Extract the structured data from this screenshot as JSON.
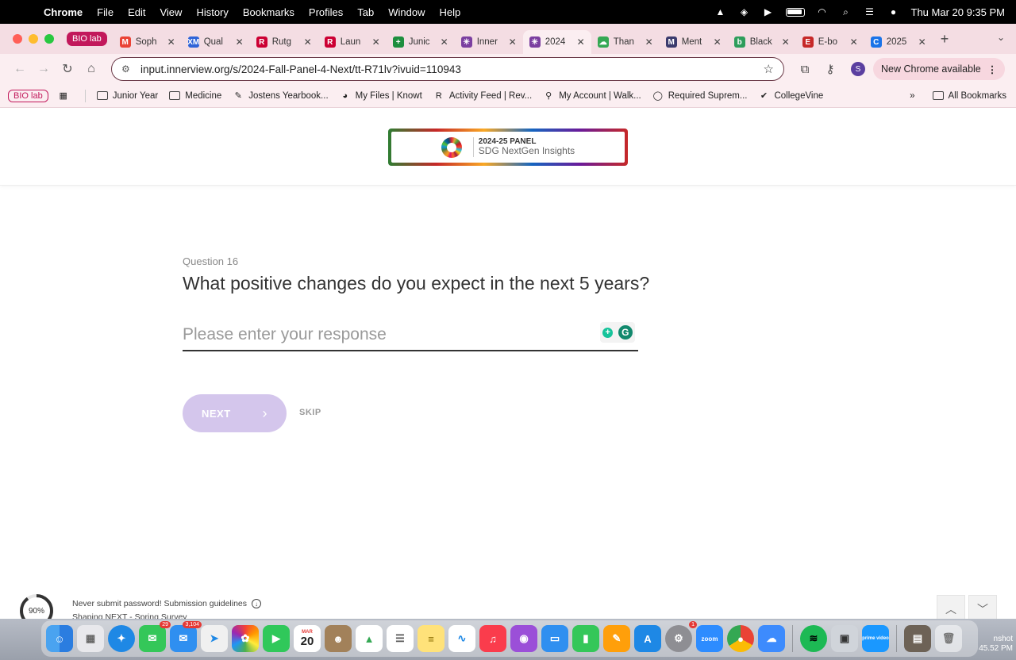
{
  "menubar": {
    "app": "Chrome",
    "items": [
      "File",
      "Edit",
      "View",
      "History",
      "Bookmarks",
      "Profiles",
      "Tab",
      "Window",
      "Help"
    ],
    "clock": "Thu Mar 20  9:35 PM"
  },
  "tabs": {
    "group_label": "BIO lab",
    "items": [
      {
        "label": "Soph",
        "favicon_color": "#ea4335",
        "favicon_glyph": "M"
      },
      {
        "label": "Qual",
        "favicon_color": "#2f64d8",
        "favicon_glyph": "XM"
      },
      {
        "label": "Rutg",
        "favicon_color": "#cc0033",
        "favicon_glyph": "R"
      },
      {
        "label": "Laun",
        "favicon_color": "#cc0033",
        "favicon_glyph": "R"
      },
      {
        "label": "Junic",
        "favicon_color": "#1e8e3e",
        "favicon_glyph": "+"
      },
      {
        "label": "Inner",
        "favicon_color": "#7b3fa0",
        "favicon_glyph": "✳"
      },
      {
        "label": "2024",
        "favicon_color": "#7b3fa0",
        "favicon_glyph": "✳"
      },
      {
        "label": "Than",
        "favicon_color": "#34a853",
        "favicon_glyph": "☁"
      },
      {
        "label": "Ment",
        "favicon_color": "#3b3b6d",
        "favicon_glyph": "M"
      },
      {
        "label": "Black",
        "favicon_color": "#2e9d5b",
        "favicon_glyph": "b"
      },
      {
        "label": "E-bo",
        "favicon_color": "#c62828",
        "favicon_glyph": "E"
      },
      {
        "label": "2025",
        "favicon_color": "#1a73e8",
        "favicon_glyph": "C"
      }
    ],
    "active_index": 6
  },
  "toolbar": {
    "url": "input.innerview.org/s/2024-Fall-Panel-4-Next/tt-R71lv?ivuid=110943",
    "profile_initial": "S",
    "update_label": "New Chrome available"
  },
  "bookmarks": {
    "group_label": "BIO lab",
    "items": [
      {
        "label": "Junior Year",
        "icon": "folder-icon"
      },
      {
        "label": "Medicine",
        "icon": "folder-icon"
      },
      {
        "label": "Jostens Yearbook...",
        "icon": "jostens-icon"
      },
      {
        "label": "My Files | Knowt",
        "icon": "knowt-icon"
      },
      {
        "label": "Activity Feed | Rev...",
        "icon": "revision-icon"
      },
      {
        "label": "My Account | Walk...",
        "icon": "walkin-icon"
      },
      {
        "label": "Required Suprem...",
        "icon": "search-q-icon"
      },
      {
        "label": "CollegeVine",
        "icon": "collegevine-icon"
      }
    ],
    "all_bookmarks": "All Bookmarks"
  },
  "logo": {
    "line1": "2024-25 PANEL",
    "line2": "SDG NextGen Insights"
  },
  "question": {
    "number_label": "Question 16",
    "text": "What positive changes do you expect in the next 5 years?",
    "placeholder": "Please enter your response",
    "value": ""
  },
  "actions": {
    "next_label": "NEXT",
    "skip_label": "SKIP"
  },
  "footer": {
    "progress_percent": 90,
    "progress_label": "90%",
    "notice": "Never submit password! Submission guidelines",
    "survey_name": "Shaping NEXT - Spring Survey"
  },
  "dock": {
    "messages_badge": "29",
    "mail_badge": "3,104",
    "calendar_month": "MAR",
    "calendar_day": "20",
    "settings_badge": "1",
    "zoom_label": "zoom",
    "prime_label": "prime video",
    "screenshot_label": "nshot",
    "screenshot_time": "45.52 PM"
  },
  "colors": {
    "tab_strip": "#f4dde3",
    "accent": "#c2185b",
    "next_button": "#d4c6ec"
  }
}
